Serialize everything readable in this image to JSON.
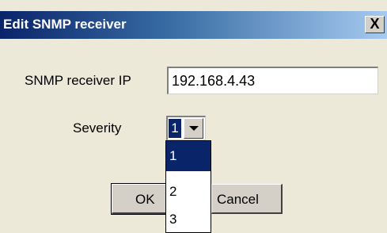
{
  "dialog": {
    "title": "Edit SNMP receiver",
    "close_label": "X"
  },
  "form": {
    "ip_label": "SNMP receiver IP",
    "ip_value": "192.168.4.43",
    "severity_label": "Severity",
    "severity_value": "1",
    "severity_options": [
      "1",
      "2",
      "3"
    ]
  },
  "buttons": {
    "ok_label": "OK",
    "cancel_label": "Cancel"
  },
  "colors": {
    "titlebar_start": "#0a246a",
    "titlebar_end": "#a6caf0",
    "selection": "#0a246a",
    "dialog_bg": "#ece9d8"
  }
}
